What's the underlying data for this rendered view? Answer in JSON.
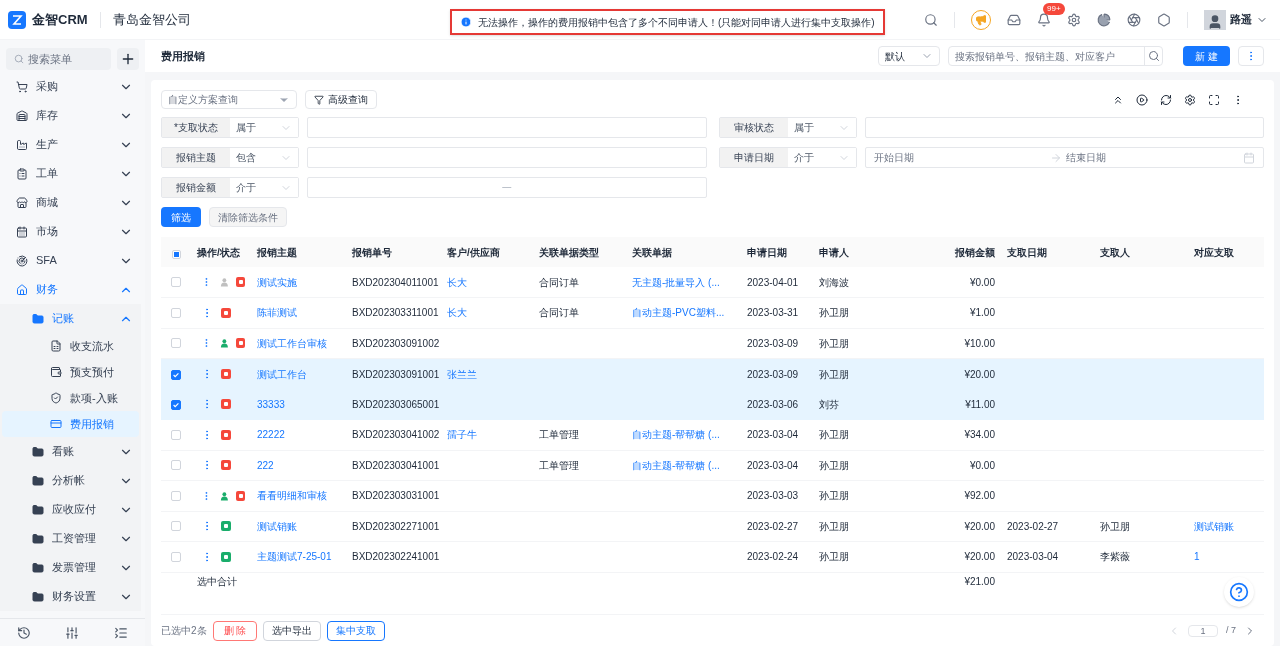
{
  "header": {
    "logo_text": "金智CRM",
    "company": "青岛金智公司",
    "alert": {
      "message": "无法操作，操作的费用报销中包含了多个不同申请人！(只能对同申请人进行集中支取操作)"
    },
    "notification_badge": "99+",
    "user": "路遥"
  },
  "sidebar": {
    "search_placeholder": "搜索菜单",
    "items": [
      {
        "label": "采购",
        "expanded": false
      },
      {
        "label": "库存",
        "expanded": false
      },
      {
        "label": "生产",
        "expanded": false
      },
      {
        "label": "工单",
        "expanded": false
      },
      {
        "label": "商城",
        "expanded": false
      },
      {
        "label": "市场",
        "expanded": false
      },
      {
        "label": "SFA",
        "expanded": false
      },
      {
        "label": "财务",
        "expanded": true,
        "children": [
          {
            "label": "记账",
            "expanded": true,
            "children": [
              {
                "label": "收支流水",
                "selected": false
              },
              {
                "label": "预支预付",
                "selected": false
              },
              {
                "label": "款项-入账",
                "selected": false
              },
              {
                "label": "费用报销",
                "selected": true
              }
            ]
          },
          {
            "label": "看账",
            "expanded": false
          },
          {
            "label": "分析帐",
            "expanded": false
          },
          {
            "label": "应收应付",
            "expanded": false
          },
          {
            "label": "工资管理",
            "expanded": false
          },
          {
            "label": "发票管理",
            "expanded": false
          },
          {
            "label": "财务设置",
            "expanded": false
          }
        ]
      }
    ]
  },
  "page": {
    "title": "费用报销",
    "view_select": "默认",
    "search_placeholder": "搜索报销单号、报销主题、对应客户",
    "new_button": "新 建"
  },
  "filters": {
    "scheme_placeholder": "自定义方案查询",
    "advanced_button": "高级查询",
    "left": [
      {
        "label": "*支取状态",
        "operator": "属于",
        "kind": "text"
      },
      {
        "label": "报销主题",
        "operator": "包含",
        "kind": "text"
      },
      {
        "label": "报销金额",
        "operator": "介于",
        "kind": "range",
        "separator": "—"
      }
    ],
    "right": [
      {
        "label": "审核状态",
        "operator": "属于",
        "kind": "text"
      },
      {
        "label": "申请日期",
        "operator": "介于",
        "kind": "date_range",
        "start_placeholder": "开始日期",
        "end_placeholder": "结束日期"
      }
    ],
    "apply_button": "筛选",
    "clear_button": {
      "label": "清除筛选条件",
      "disabled": true
    }
  },
  "table": {
    "select_all": {
      "indeterminate": true
    },
    "columns": [
      "操作/状态",
      "报销主题",
      "报销单号",
      "客户/供应商",
      "关联单据类型",
      "关联单据",
      "申请日期",
      "申请人",
      "报销金额",
      "支取日期",
      "支取人",
      "对应支取"
    ],
    "rows": [
      {
        "checked": false,
        "status": [
          {
            "kind": "person",
            "color": "#c0c0c0"
          },
          {
            "kind": "doc",
            "color": "#f5483b"
          }
        ],
        "subject": "测试实施",
        "number": "BXD202304011001",
        "customer": "长大",
        "link_type": "合同订单",
        "link": "无主题-批量导入 (...",
        "date": "2023-04-01",
        "applicant": "刘海波",
        "amount": "¥0.00",
        "pay_date": "",
        "payee": "",
        "payment": ""
      },
      {
        "checked": false,
        "status": [
          {
            "kind": "doc",
            "color": "#f5483b"
          }
        ],
        "subject": "陈菲测试",
        "number": "BXD202303311001",
        "customer": "长大",
        "link_type": "合同订单",
        "link": "自动主题-PVC塑料...",
        "date": "2023-03-31",
        "applicant": "孙卫朋",
        "amount": "¥1.00",
        "pay_date": "",
        "payee": "",
        "payment": ""
      },
      {
        "checked": false,
        "status": [
          {
            "kind": "person",
            "color": "#1aad6b"
          },
          {
            "kind": "doc",
            "color": "#f5483b"
          }
        ],
        "subject": "测试工作台审核",
        "number": "BXD202303091002",
        "customer": "",
        "link_type": "",
        "link": "",
        "date": "2023-03-09",
        "applicant": "孙卫朋",
        "amount": "¥10.00",
        "pay_date": "",
        "payee": "",
        "payment": ""
      },
      {
        "checked": true,
        "status": [
          {
            "kind": "doc",
            "color": "#f5483b"
          }
        ],
        "subject": "测试工作台",
        "number": "BXD202303091001",
        "customer": "张兰兰",
        "link_type": "",
        "link": "",
        "date": "2023-03-09",
        "applicant": "孙卫朋",
        "amount": "¥20.00",
        "pay_date": "",
        "payee": "",
        "payment": ""
      },
      {
        "checked": true,
        "status": [
          {
            "kind": "doc",
            "color": "#f5483b"
          }
        ],
        "subject": "33333",
        "number": "BXD202303065001",
        "customer": "",
        "link_type": "",
        "link": "",
        "date": "2023-03-06",
        "applicant": "刘芬",
        "amount": "¥11.00",
        "pay_date": "",
        "payee": "",
        "payment": ""
      },
      {
        "checked": false,
        "status": [
          {
            "kind": "doc",
            "color": "#f5483b"
          }
        ],
        "subject": "22222",
        "number": "BXD202303041002",
        "customer": "孺子牛",
        "link_type": "工单管理",
        "link": "自动主题-帮帮糖 (...",
        "date": "2023-03-04",
        "applicant": "孙卫朋",
        "amount": "¥34.00",
        "pay_date": "",
        "payee": "",
        "payment": ""
      },
      {
        "checked": false,
        "status": [
          {
            "kind": "doc",
            "color": "#f5483b"
          }
        ],
        "subject": "222",
        "number": "BXD202303041001",
        "customer": "",
        "link_type": "工单管理",
        "link": "自动主题-帮帮糖 (...",
        "date": "2023-03-04",
        "applicant": "孙卫朋",
        "amount": "¥0.00",
        "pay_date": "",
        "payee": "",
        "payment": ""
      },
      {
        "checked": false,
        "status": [
          {
            "kind": "person",
            "color": "#1aad6b"
          },
          {
            "kind": "doc",
            "color": "#f5483b"
          }
        ],
        "subject": "看看明细和审核",
        "number": "BXD202303031001",
        "customer": "",
        "link_type": "",
        "link": "",
        "date": "2023-03-03",
        "applicant": "孙卫朋",
        "amount": "¥92.00",
        "pay_date": "",
        "payee": "",
        "payment": ""
      },
      {
        "checked": false,
        "status": [
          {
            "kind": "doc",
            "color": "#1aad6b"
          }
        ],
        "subject": "测试销账",
        "number": "BXD202302271001",
        "customer": "",
        "link_type": "",
        "link": "",
        "date": "2023-02-27",
        "applicant": "孙卫朋",
        "amount": "¥20.00",
        "pay_date": "2023-02-27",
        "payee": "孙卫朋",
        "payment": "测试销账"
      },
      {
        "checked": false,
        "status": [
          {
            "kind": "doc",
            "color": "#1aad6b"
          }
        ],
        "subject": "主题测试7-25-01",
        "number": "BXD202302241001",
        "customer": "",
        "link_type": "",
        "link": "",
        "date": "2023-02-24",
        "applicant": "孙卫朋",
        "amount": "¥20.00",
        "pay_date": "2023-03-04",
        "payee": "李紫薇",
        "payment": "1"
      }
    ],
    "summary": {
      "label": "选中合计",
      "amount": "¥21.00"
    }
  },
  "footer": {
    "selected_count": "已选中2条",
    "delete_button": "删 除",
    "export_button": "选中导出",
    "pay_button": "集中支取",
    "page_input": "1",
    "page_total": "/ 7"
  }
}
